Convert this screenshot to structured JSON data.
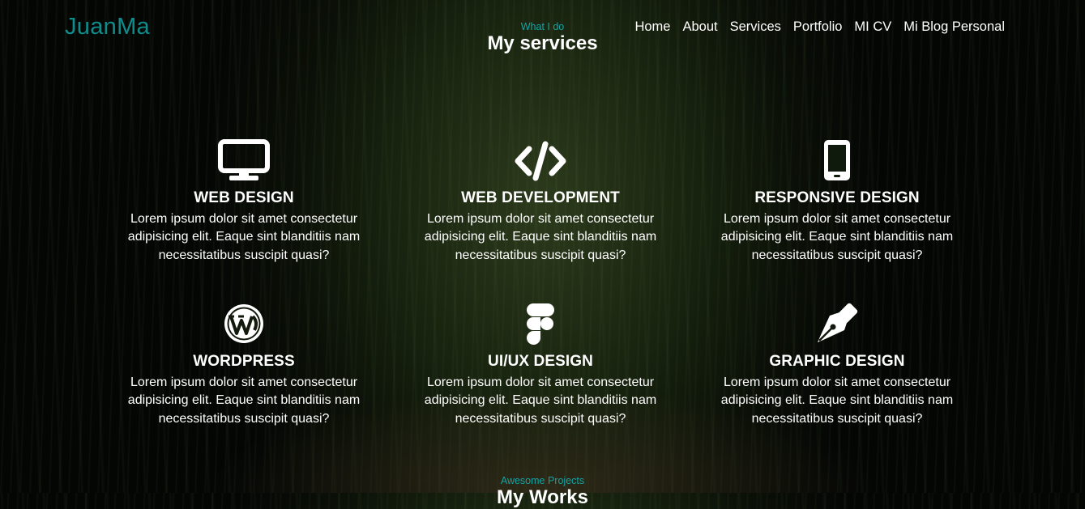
{
  "brand": "JuanMa",
  "nav": [
    "Home",
    "About",
    "Services",
    "Portfolio",
    "MI CV",
    "Mi Blog Personal"
  ],
  "services_section": {
    "kicker": "What I do",
    "title": "My services",
    "items": [
      {
        "icon": "monitor-icon",
        "title": "WEB DESIGN",
        "text": "Lorem ipsum dolor sit amet consectetur adipisicing elit. Eaque sint blanditiis nam necessitatibus suscipit quasi?"
      },
      {
        "icon": "code-icon",
        "title": "WEB DEVELOPMENT",
        "text": "Lorem ipsum dolor sit amet consectetur adipisicing elit. Eaque sint blanditiis nam necessitatibus suscipit quasi?"
      },
      {
        "icon": "mobile-icon",
        "title": "RESPONSIVE DESIGN",
        "text": "Lorem ipsum dolor sit amet consectetur adipisicing elit. Eaque sint blanditiis nam necessitatibus suscipit quasi?"
      },
      {
        "icon": "wordpress-icon",
        "title": "WORDPRESS",
        "text": "Lorem ipsum dolor sit amet consectetur adipisicing elit. Eaque sint blanditiis nam necessitatibus suscipit quasi?"
      },
      {
        "icon": "figma-icon",
        "title": "UI/UX DESIGN",
        "text": "Lorem ipsum dolor sit amet consectetur adipisicing elit. Eaque sint blanditiis nam necessitatibus suscipit quasi?"
      },
      {
        "icon": "pen-nib-icon",
        "title": "GRAPHIC DESIGN",
        "text": "Lorem ipsum dolor sit amet consectetur adipisicing elit. Eaque sint blanditiis nam necessitatibus suscipit quasi?"
      }
    ]
  },
  "works_section": {
    "kicker": "Awesome Projects",
    "title": "My Works"
  },
  "colors": {
    "accent": "#0f8c8c",
    "kicker": "#13a3a3",
    "text": "#ffffff"
  }
}
